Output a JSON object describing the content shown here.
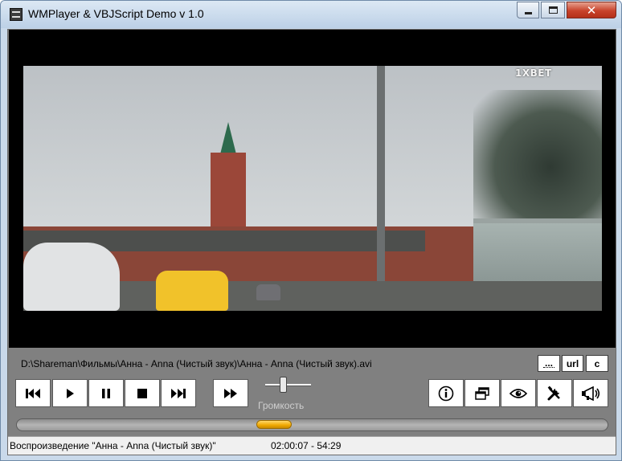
{
  "window": {
    "title": "WMPlayer & VBJScript Demo v 1.0",
    "close_glyph": "✕"
  },
  "video": {
    "watermark": "1XBET"
  },
  "file": {
    "path": "D:\\Shareman\\Фильмы\\Анна - Anna (Чистый звук)\\Анна - Anna (Чистый звук).avi"
  },
  "buttons": {
    "browse_label": "...",
    "url_label": "url",
    "c_label": "c"
  },
  "volume": {
    "label": "Громкость",
    "level": 0.37
  },
  "seek": {
    "position_fraction": 0.435
  },
  "status": {
    "text": "Воспроизведение \"Анна - Anna (Чистый звук)\"",
    "time": "02:00:07 - 54:29"
  },
  "icons": {
    "previous": "skip-back-icon",
    "play": "play-icon",
    "pause": "pause-icon",
    "stop": "stop-icon",
    "next": "skip-forward-icon",
    "fast_forward": "fast-forward-icon",
    "info": "info-icon",
    "windows": "windows-icon",
    "eye": "eye-icon",
    "tools": "tools-icon",
    "megaphone": "megaphone-icon"
  }
}
